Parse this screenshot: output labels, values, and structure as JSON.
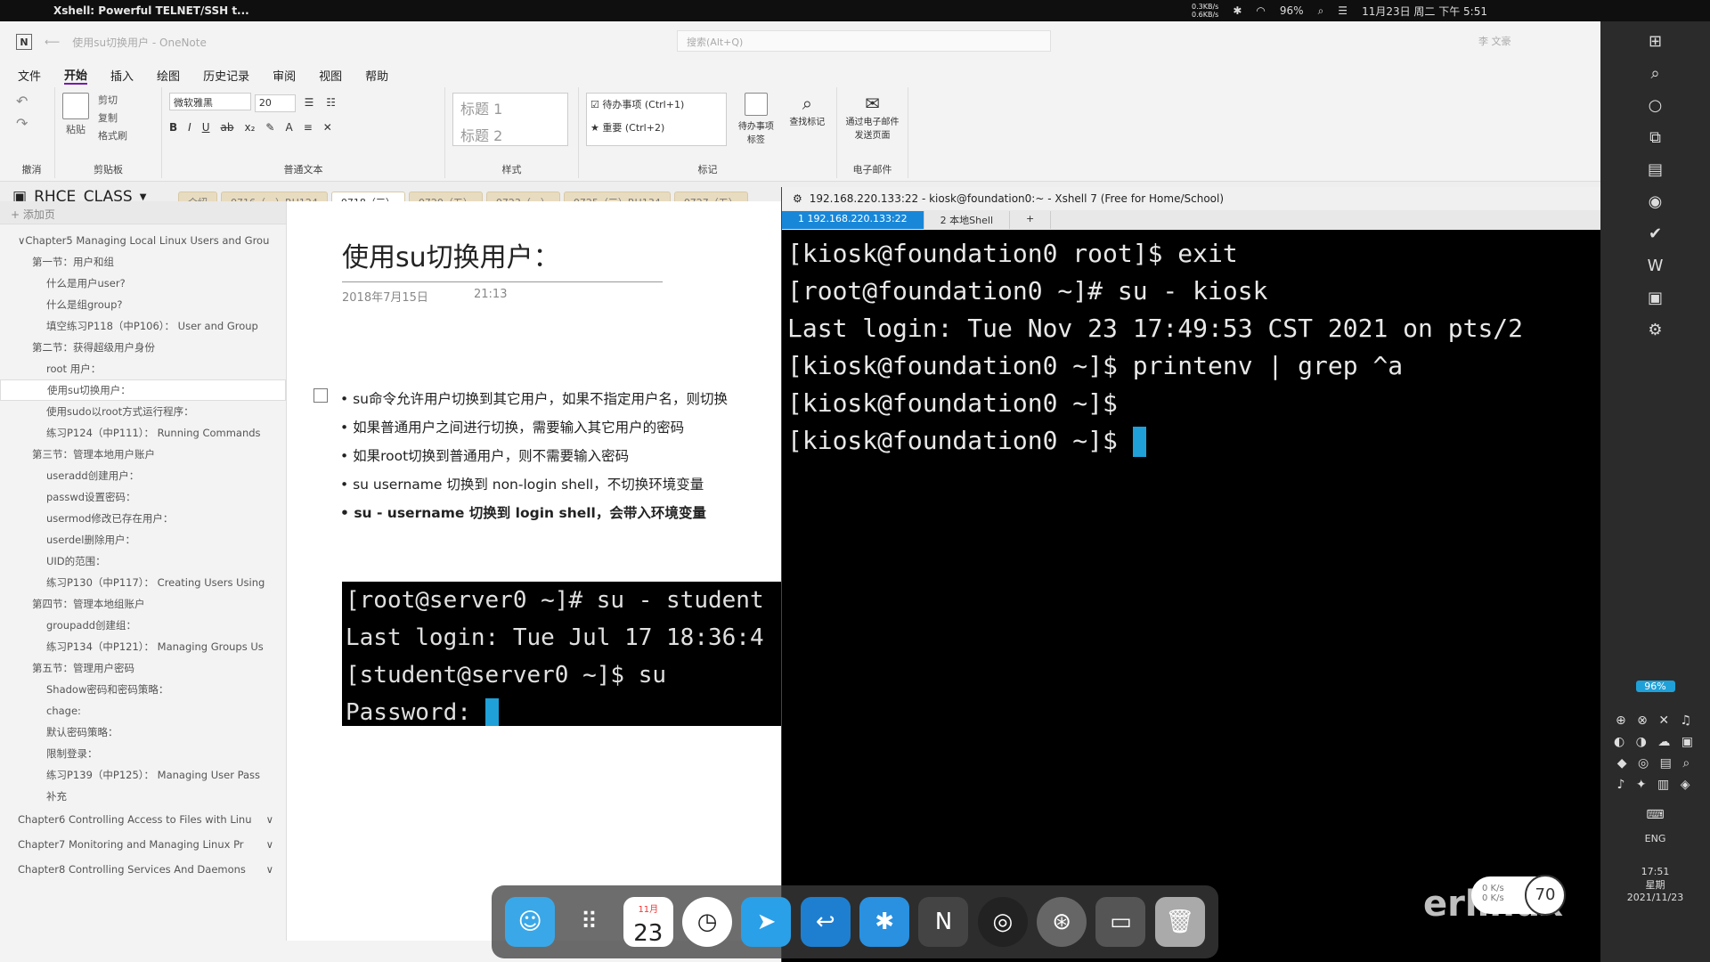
{
  "menubar": {
    "app_title": "Xshell: Powerful TELNET/SSH t...",
    "net_up": "0.3KB/s",
    "net_down": "0.6KB/s",
    "battery": "96%",
    "datetime": "11月23日 周二 下午 5:51"
  },
  "onenote": {
    "window_title": "使用su切换用户 - OneNote",
    "search_placeholder": "搜索(Alt+Q)",
    "user_name": "李 文豪",
    "menu": [
      "文件",
      "开始",
      "插入",
      "绘图",
      "历史记录",
      "审阅",
      "视图",
      "帮助"
    ],
    "ribbon": {
      "undo_label": "撤消",
      "paste": "粘贴",
      "cut": "剪切",
      "copy": "复制",
      "format_painter": "格式刷",
      "clipboard_label": "剪贴板",
      "font_name": "微软雅黑",
      "font_size": "20",
      "basic_text_label": "普通文本",
      "heading1": "标题 1",
      "heading2": "标题 2",
      "styles_label": "样式",
      "todo_tag": "待办事项 (Ctrl+1)",
      "important_tag": "重要 (Ctrl+2)",
      "todo_btn": "待办事项标签",
      "find_tags": "查找标记",
      "tags_label": "标记",
      "email_page": "通过电子邮件发送页面",
      "email_label": "电子邮件"
    },
    "notebook": "RHCE_CLASS",
    "section_tabs": [
      "介绍",
      "0716（一）RH124",
      "0718（三）",
      "0720（五）",
      "0723（一）",
      "0725（三）RH134",
      "0727（五）"
    ],
    "active_tab_index": 2,
    "add_page": "+ 添加页",
    "pages": [
      {
        "label": "Chapter5 Managing Local Linux Users and Grou",
        "level": 0
      },
      {
        "label": "第一节：用户和组",
        "level": 1
      },
      {
        "label": "什么是用户user?",
        "level": 2
      },
      {
        "label": "什么是组group?",
        "level": 2
      },
      {
        "label": "填空练习P118（中P106）：  User and Group",
        "level": 2
      },
      {
        "label": "第二节：获得超级用户身份",
        "level": 1
      },
      {
        "label": "root 用户：",
        "level": 2
      },
      {
        "label": "使用su切换用户：",
        "level": 2,
        "selected": true
      },
      {
        "label": "使用sudo以root方式运行程序：",
        "level": 2
      },
      {
        "label": "练习P124（中P111）：  Running Commands",
        "level": 2
      },
      {
        "label": "第三节：管理本地用户账户",
        "level": 1
      },
      {
        "label": "useradd创建用户：",
        "level": 2
      },
      {
        "label": "passwd设置密码：",
        "level": 2
      },
      {
        "label": "usermod修改已存在用户：",
        "level": 2
      },
      {
        "label": "userdel删除用户：",
        "level": 2
      },
      {
        "label": "UID的范围：",
        "level": 2
      },
      {
        "label": "练习P130（中P117）：  Creating Users Using",
        "level": 2
      },
      {
        "label": "第四节：管理本地组账户",
        "level": 1
      },
      {
        "label": "groupadd创建组：",
        "level": 2
      },
      {
        "label": "练习P134（中P121）：  Managing Groups Us",
        "level": 2
      },
      {
        "label": "第五节：管理用户密码",
        "level": 1
      },
      {
        "label": "Shadow密码和密码策略：",
        "level": 2
      },
      {
        "label": "chage:",
        "level": 2
      },
      {
        "label": "默认密码策略：",
        "level": 2
      },
      {
        "label": "限制登录：",
        "level": 2
      },
      {
        "label": "练习P139（中P125）：  Managing User Pass",
        "level": 2
      },
      {
        "label": "补充",
        "level": 2
      }
    ],
    "collapsed_chapters": [
      "Chapter6 Controlling Access to Files with Linu",
      "Chapter7 Monitoring and Managing Linux Pr",
      "Chapter8 Controlling Services And Daemons"
    ],
    "page": {
      "title": "使用su切换用户：",
      "date": "2018年7月15日",
      "time": "21:13",
      "bullets": [
        {
          "text": "su命令允许用户切换到其它用户，如果不指定用户名，则切换",
          "bold": false
        },
        {
          "text": "如果普通用户之间进行切换，需要输入其它用户的密码",
          "bold": false
        },
        {
          "text": "如果root切换到普通用户，则不需要输入密码",
          "bold": false
        },
        {
          "text": "su username 切换到 non-login shell，不切换环境变量",
          "bold": false
        },
        {
          "text": "su - username 切换到 login shell，会带入环境变量",
          "bold": true
        }
      ],
      "embedded_terminal": [
        "[root@server0 ~]# su - student",
        "Last login: Tue Jul 17 18:36:4",
        "[student@server0 ~]$ su",
        "Password: "
      ]
    }
  },
  "xshell": {
    "title": "192.168.220.133:22 - kiosk@foundation0:~ - Xshell 7 (Free for Home/School)",
    "tabs": [
      "1 192.168.220.133:22",
      "2 本地Shell"
    ],
    "terminal_lines": [
      "[kiosk@foundation0 root]$ exit",
      "[root@foundation0 ~]# su - kiosk",
      "Last login: Tue Nov 23 17:49:53 CST 2021 on pts/2",
      "[kiosk@foundation0 ~]$ printenv | grep ^a",
      "[kiosk@foundation0 ~]$",
      "[kiosk@foundation0 ~]$ "
    ]
  },
  "dock": {
    "calendar_month": "11月",
    "calendar_day": "23",
    "apps": [
      "finder-icon",
      "launchpad-icon",
      "calendar-icon",
      "clock-icon",
      "feishu-icon",
      "screen-icon",
      "star-icon",
      "onenote-icon",
      "obs-icon",
      "steering-icon",
      "presentation-icon",
      "trash-icon"
    ]
  },
  "right_panel": {
    "battery": "96%",
    "lang": "ENG",
    "clock": "17:51",
    "weekday": "星期",
    "date": "2021/11/23"
  },
  "overlay": {
    "watermark": "erlinux",
    "speed_up": "0 K/s",
    "speed_down": "0 K/s",
    "gauge": "70"
  }
}
